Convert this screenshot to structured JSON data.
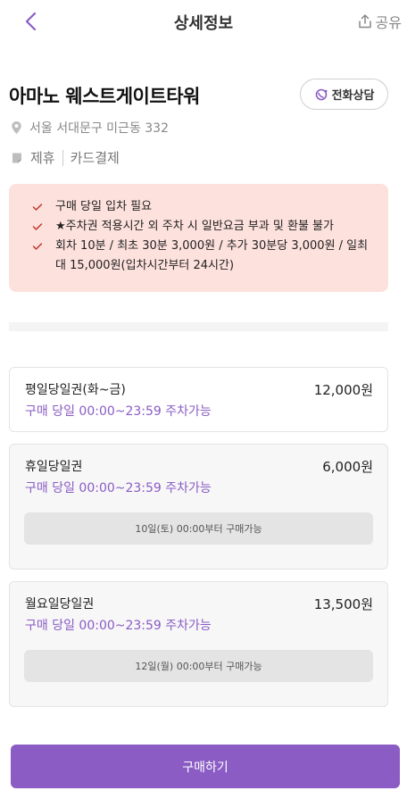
{
  "header": {
    "title": "상세정보",
    "share_label": "공유"
  },
  "lot": {
    "name": "아마노 웨스트게이트타워",
    "call_label": "전화상담",
    "address": "서울 서대문구 미근동 332",
    "tags": [
      "제휴",
      "카드결제"
    ]
  },
  "notices": [
    "구매 당일 입차 필요",
    "★주차권 적용시간 외 주차 시 일반요금 부과 및 환불 불가",
    "회차 10분 / 최초 30분 3,000원 / 추가 30분당 3,000원 / 일최대 15,000원(입차시간부터 24시간)"
  ],
  "tickets": [
    {
      "name": "평일당일권(화~금)",
      "price": "12,000원",
      "time": "구매 당일 00:00~23:59 주차가능"
    },
    {
      "name": "휴일당일권",
      "price": "6,000원",
      "time": "구매 당일 00:00~23:59 주차가능",
      "availability": "10일(토) 00:00부터 구매가능"
    },
    {
      "name": "월요일당일권",
      "price": "13,500원",
      "time": "구매 당일 00:00~23:59 주차가능",
      "availability": "12일(월) 00:00부터 구매가능"
    }
  ],
  "buy_label": "구매하기",
  "colors": {
    "accent": "#8a5cc4",
    "notice_bg": "#fde1dd",
    "check": "#c0392b"
  }
}
